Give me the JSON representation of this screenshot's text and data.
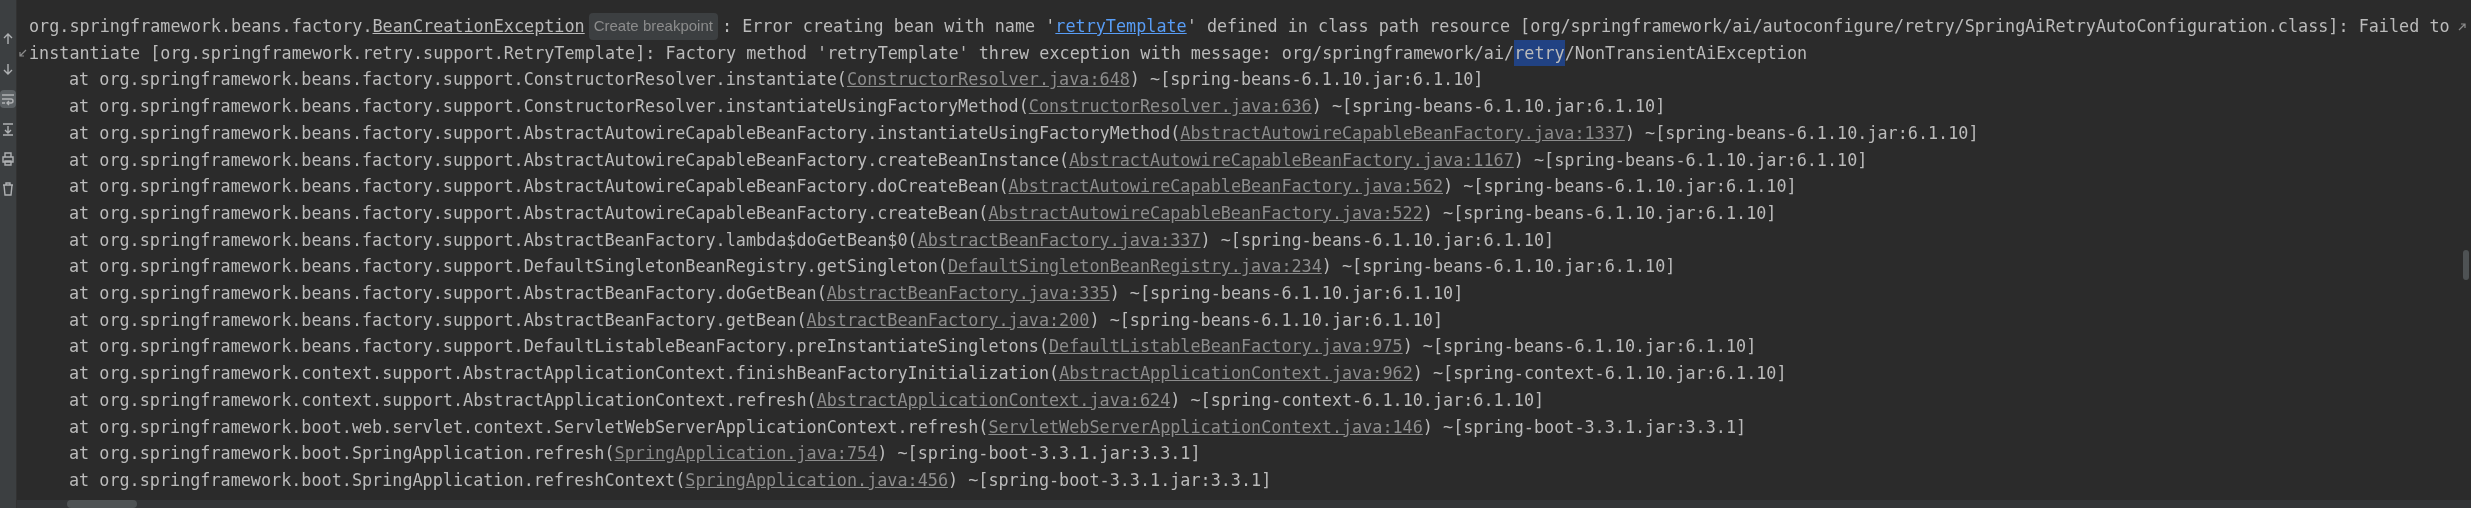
{
  "toolbar": [
    {
      "kind": "up",
      "selected": false
    },
    {
      "kind": "down",
      "selected": false
    },
    {
      "kind": "wrap",
      "selected": true
    },
    {
      "kind": "scroll-end",
      "selected": false
    },
    {
      "kind": "print",
      "selected": false
    },
    {
      "kind": "trash",
      "selected": false
    }
  ],
  "message_lines": [
    {
      "wrapped": false,
      "end_wrap": true,
      "segments": [
        {
          "kind": "text",
          "text": "org.springframework.beans.factory."
        },
        {
          "kind": "file_link",
          "text": "BeanCreationException"
        },
        {
          "kind": "hint",
          "text": "Create breakpoint"
        },
        {
          "kind": "text",
          "text": ": Error creating bean with name '"
        },
        {
          "kind": "bean_link",
          "text": "retryTemplate"
        },
        {
          "kind": "text",
          "text": "' defined in class path resource [org/springframework/ai/autoconfigure/retry/SpringAiRetryAutoConfiguration.class]: Failed to"
        }
      ]
    },
    {
      "wrapped": true,
      "end_wrap": false,
      "segments": [
        {
          "kind": "text",
          "text": "instantiate [org.springframework.retry.support.RetryTemplate]: Factory method 'retryTemplate' threw exception with message: org/springframework/ai/"
        },
        {
          "kind": "selection",
          "text": "retry"
        },
        {
          "kind": "text",
          "text": "/NonTransientAiException"
        }
      ]
    }
  ],
  "frames": [
    {
      "call": "at org.springframework.beans.factory.support.ConstructorResolver.instantiate(",
      "source": "ConstructorResolver.java:648",
      "jar": ") ~[spring-beans-6.1.10.jar:6.1.10]"
    },
    {
      "call": "at org.springframework.beans.factory.support.ConstructorResolver.instantiateUsingFactoryMethod(",
      "source": "ConstructorResolver.java:636",
      "jar": ") ~[spring-beans-6.1.10.jar:6.1.10]"
    },
    {
      "call": "at org.springframework.beans.factory.support.AbstractAutowireCapableBeanFactory.instantiateUsingFactoryMethod(",
      "source": "AbstractAutowireCapableBeanFactory.java:1337",
      "jar": ") ~[spring-beans-6.1.10.jar:6.1.10]"
    },
    {
      "call": "at org.springframework.beans.factory.support.AbstractAutowireCapableBeanFactory.createBeanInstance(",
      "source": "AbstractAutowireCapableBeanFactory.java:1167",
      "jar": ") ~[spring-beans-6.1.10.jar:6.1.10]"
    },
    {
      "call": "at org.springframework.beans.factory.support.AbstractAutowireCapableBeanFactory.doCreateBean(",
      "source": "AbstractAutowireCapableBeanFactory.java:562",
      "jar": ") ~[spring-beans-6.1.10.jar:6.1.10]"
    },
    {
      "call": "at org.springframework.beans.factory.support.AbstractAutowireCapableBeanFactory.createBean(",
      "source": "AbstractAutowireCapableBeanFactory.java:522",
      "jar": ") ~[spring-beans-6.1.10.jar:6.1.10]"
    },
    {
      "call": "at org.springframework.beans.factory.support.AbstractBeanFactory.lambda$doGetBean$0(",
      "source": "AbstractBeanFactory.java:337",
      "jar": ") ~[spring-beans-6.1.10.jar:6.1.10]"
    },
    {
      "call": "at org.springframework.beans.factory.support.DefaultSingletonBeanRegistry.getSingleton(",
      "source": "DefaultSingletonBeanRegistry.java:234",
      "jar": ") ~[spring-beans-6.1.10.jar:6.1.10]"
    },
    {
      "call": "at org.springframework.beans.factory.support.AbstractBeanFactory.doGetBean(",
      "source": "AbstractBeanFactory.java:335",
      "jar": ") ~[spring-beans-6.1.10.jar:6.1.10]"
    },
    {
      "call": "at org.springframework.beans.factory.support.AbstractBeanFactory.getBean(",
      "source": "AbstractBeanFactory.java:200",
      "jar": ") ~[spring-beans-6.1.10.jar:6.1.10]"
    },
    {
      "call": "at org.springframework.beans.factory.support.DefaultListableBeanFactory.preInstantiateSingletons(",
      "source": "DefaultListableBeanFactory.java:975",
      "jar": ") ~[spring-beans-6.1.10.jar:6.1.10]"
    },
    {
      "call": "at org.springframework.context.support.AbstractApplicationContext.finishBeanFactoryInitialization(",
      "source": "AbstractApplicationContext.java:962",
      "jar": ") ~[spring-context-6.1.10.jar:6.1.10]"
    },
    {
      "call": "at org.springframework.context.support.AbstractApplicationContext.refresh(",
      "source": "AbstractApplicationContext.java:624",
      "jar": ") ~[spring-context-6.1.10.jar:6.1.10]"
    },
    {
      "call": "at org.springframework.boot.web.servlet.context.ServletWebServerApplicationContext.refresh(",
      "source": "ServletWebServerApplicationContext.java:146",
      "jar": ") ~[spring-boot-3.3.1.jar:3.3.1]"
    },
    {
      "call": "at org.springframework.boot.SpringApplication.refresh(",
      "source": "SpringApplication.java:754",
      "jar": ") ~[spring-boot-3.3.1.jar:3.3.1]"
    },
    {
      "call": "at org.springframework.boot.SpringApplication.refreshContext(",
      "source": "SpringApplication.java:456",
      "jar": ") ~[spring-boot-3.3.1.jar:3.3.1]"
    }
  ]
}
